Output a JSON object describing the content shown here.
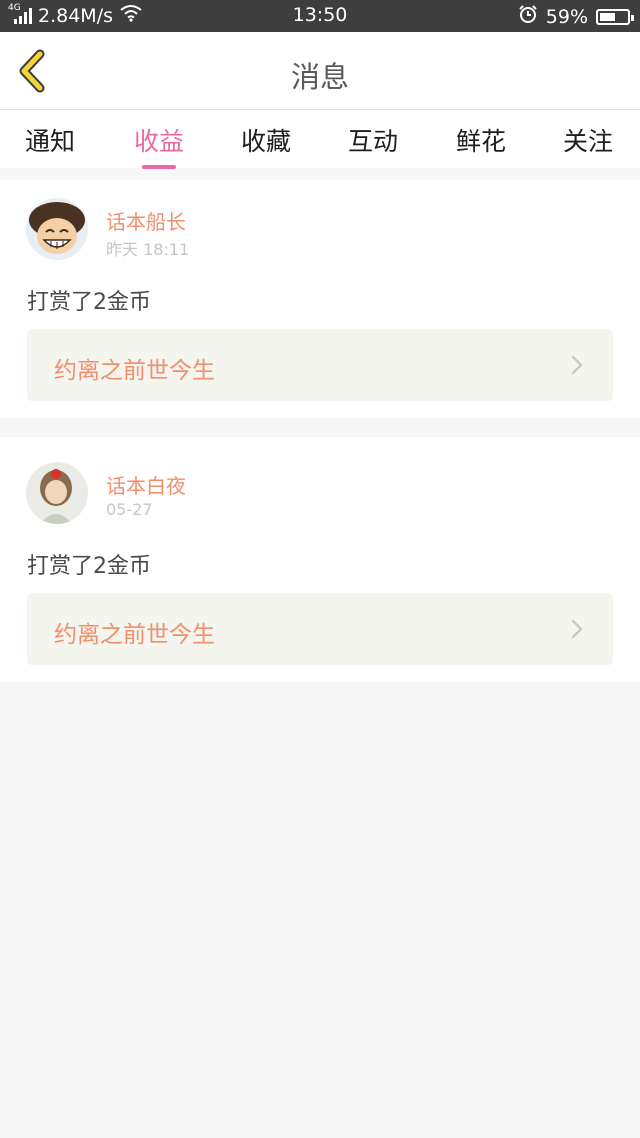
{
  "status_bar": {
    "network": "4G",
    "speed": "2.84M/s",
    "time": "13:50",
    "battery": "59%",
    "battery_level": 0.59
  },
  "header": {
    "title": "消息",
    "back_icon": "chevron-left-icon",
    "accent_color": "#f5d536"
  },
  "tabs": [
    {
      "label": "通知",
      "active": false
    },
    {
      "label": "收益",
      "active": true
    },
    {
      "label": "收藏",
      "active": false
    },
    {
      "label": "互动",
      "active": false
    },
    {
      "label": "鲜花",
      "active": false
    },
    {
      "label": "关注",
      "active": false
    }
  ],
  "colors": {
    "active_tab": "#e86aa0",
    "username": "#f08f6c",
    "book_title": "#f08f6c"
  },
  "messages": [
    {
      "user": "话本船长",
      "time": "昨天 18:11",
      "text": "打赏了2金币",
      "book": "约离之前世今生"
    },
    {
      "user": "话本白夜",
      "time": "05-27",
      "text": "打赏了2金币",
      "book": "约离之前世今生"
    }
  ]
}
